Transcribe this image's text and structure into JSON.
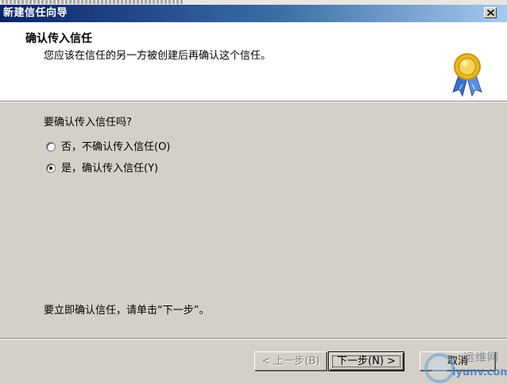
{
  "window": {
    "title": "新建信任向导"
  },
  "header": {
    "title": "确认传入信任",
    "subtitle": "您应该在信任的另一方被创建后再确认这个信任。"
  },
  "content": {
    "question": "要确认传入信任吗?",
    "options": [
      {
        "label": "否，不确认传入信任(O)",
        "selected": false
      },
      {
        "label": "是，确认传入信任(Y)",
        "selected": true
      }
    ],
    "instruction": "要立即确认信任，请单击“下一步”。"
  },
  "buttons": {
    "back_label": "< 上一步(B)",
    "next_label": "下一步(N) >",
    "cancel_label": "取消"
  },
  "watermark": {
    "line1": "运维网",
    "line2": "iyunv.com"
  },
  "icons": {
    "header_badge": "award-ribbon-icon",
    "close": "close-icon"
  },
  "colors": {
    "titlebar_start": "#0a246a",
    "titlebar_end": "#a6caf0",
    "dialog_face": "#d4d0c8",
    "badge_gold": "#e8b820",
    "badge_ribbon": "#3a6ec8"
  }
}
